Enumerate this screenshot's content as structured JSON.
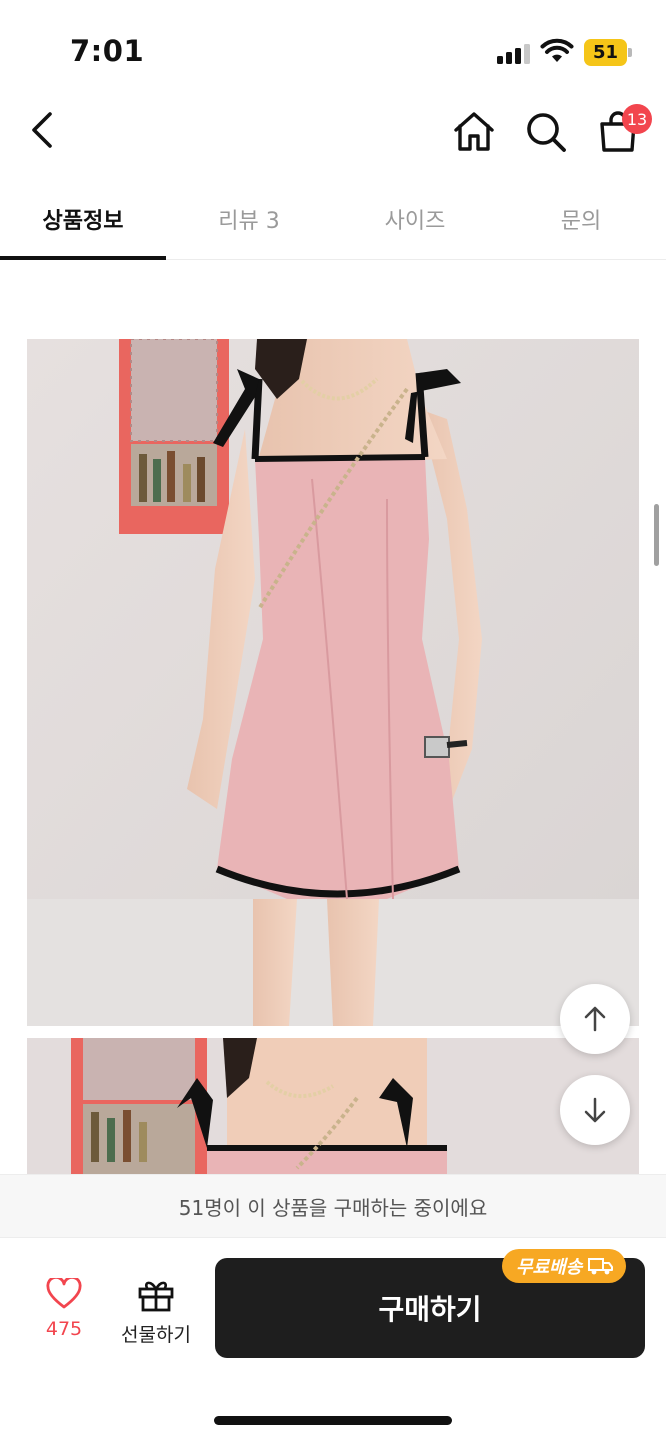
{
  "status_bar": {
    "time": "7:01",
    "battery_level": "51"
  },
  "nav": {
    "back_icon": "chevron-left-icon",
    "home_icon": "home-icon",
    "search_icon": "search-icon",
    "cart_icon": "shopping-bag-icon",
    "cart_badge": "13"
  },
  "tabs": [
    {
      "label": "상품정보",
      "active": true
    },
    {
      "label": "리뷰 3",
      "active": false
    },
    {
      "label": "사이즈",
      "active": false
    },
    {
      "label": "문의",
      "active": false
    }
  ],
  "scroll_buttons": {
    "up_icon": "arrow-up-icon",
    "down_icon": "arrow-down-icon"
  },
  "purchase_note": "51명이 이 상품을 구매하는 중이에요",
  "actions": {
    "like_count": "475",
    "gift_label": "선물하기",
    "buy_label": "구매하기",
    "free_shipping_label": "무료배송"
  },
  "colors": {
    "accent_red": "#f2454e",
    "buy_button": "#1e1e1e",
    "free_shipping": "#f7a823",
    "dress_pink": "#e9b4b6"
  }
}
